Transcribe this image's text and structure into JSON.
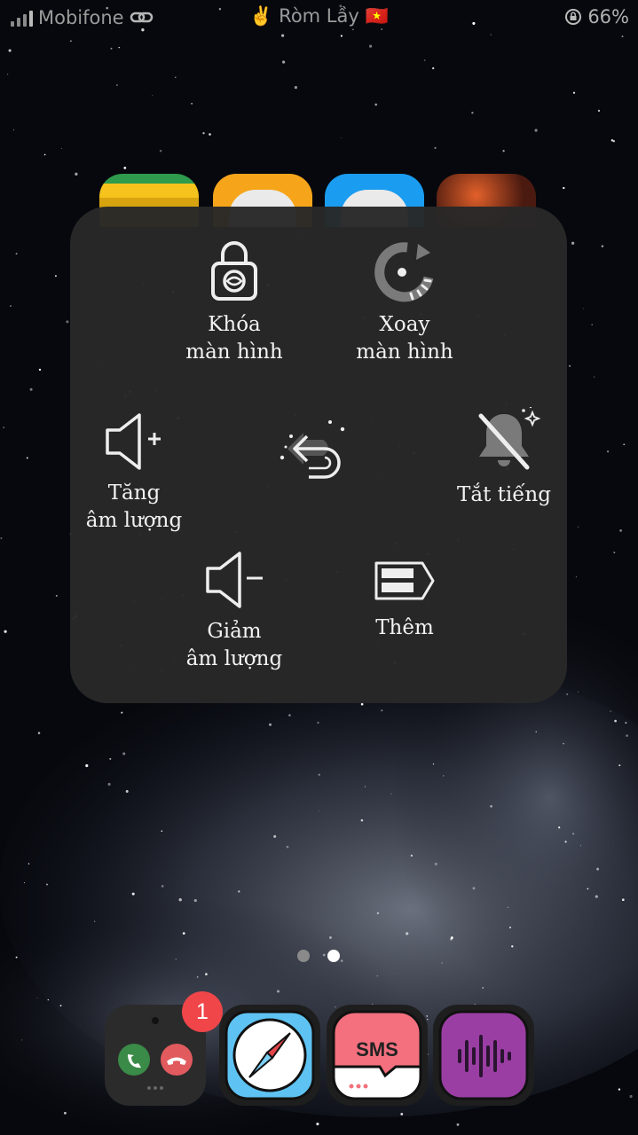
{
  "status_bar": {
    "carrier": "Mobifone",
    "center_text": "✌️ Ròm Lầy 🇻🇳",
    "battery": "66%"
  },
  "assistive_menu": {
    "lock_screen": "Khóa\nmàn hình",
    "rotate_screen": "Xoay\nmàn hình",
    "volume_up": "Tăng\nâm lượng",
    "mute": "Tắt tiếng",
    "volume_down": "Giảm\nâm lượng",
    "more": "Thêm",
    "back_icon": "back-arrow-icon"
  },
  "dock": {
    "phone_badge": "1",
    "apps": [
      "phone-app-icon",
      "safari-app-icon",
      "sms-app-icon",
      "voice-memos-app-icon"
    ]
  },
  "colors": {
    "panel_bg": "#282828",
    "badge": "#f0464a",
    "sms_pink": "#f4707e",
    "voice_purple": "#9b3ea4"
  }
}
